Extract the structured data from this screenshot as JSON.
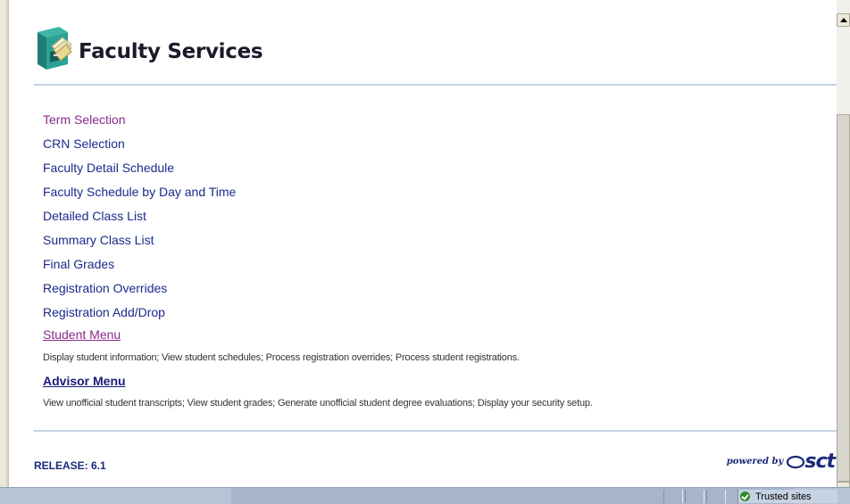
{
  "header": {
    "title": "Faculty Services",
    "logo_icon": "file-cabinet-icon"
  },
  "menu": {
    "items": [
      {
        "label": "Term Selection",
        "visited": true
      },
      {
        "label": "CRN Selection",
        "visited": false
      },
      {
        "label": "Faculty Detail Schedule",
        "visited": false
      },
      {
        "label": "Faculty Schedule by Day and Time",
        "visited": false
      },
      {
        "label": "Detailed Class List",
        "visited": false
      },
      {
        "label": "Summary Class List",
        "visited": false
      },
      {
        "label": "Final Grades",
        "visited": false
      },
      {
        "label": "Registration Overrides",
        "visited": false
      },
      {
        "label": "Registration Add/Drop",
        "visited": false
      }
    ],
    "student_menu": {
      "label": "Student Menu",
      "description": "Display student information; View student schedules; Process registration overrides; Process student registrations."
    },
    "advisor_menu": {
      "label": "Advisor Menu",
      "description": "View unofficial student transcripts; View student grades; Generate unofficial student degree evaluations; Display your security setup."
    }
  },
  "footer": {
    "release": "RELEASE: 6.1",
    "powered_by": "powered by",
    "brand": "sct"
  },
  "statusbar": {
    "zone_label": "Trusted sites",
    "zone_icon": "check-icon"
  },
  "colors": {
    "link": "#1a2a8a",
    "visited_link": "#8a2a8a",
    "rule": "#c5d2e3",
    "statusbar": "#b8c4d6"
  }
}
